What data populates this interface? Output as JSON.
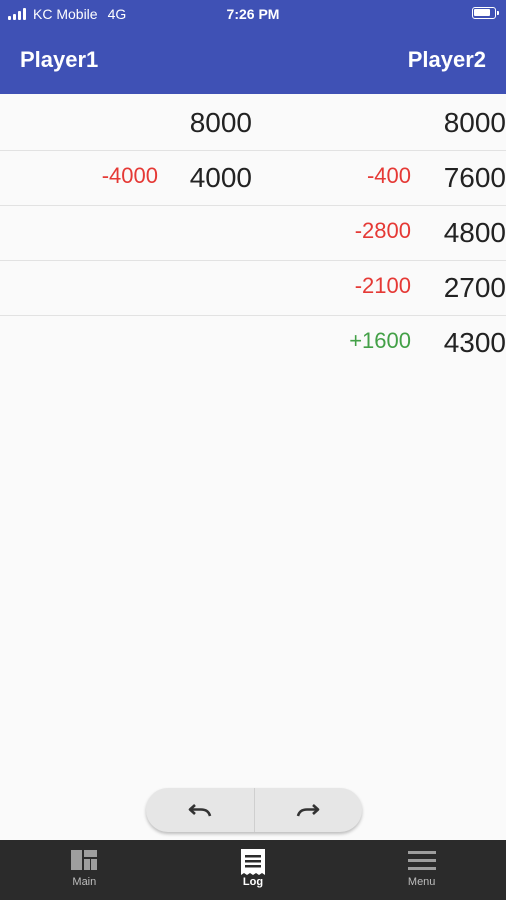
{
  "status_bar": {
    "carrier": "KC Mobile",
    "network": "4G",
    "time": "7:26 PM",
    "battery_level": 0.85
  },
  "header": {
    "player1": "Player1",
    "player2": "Player2"
  },
  "log_rows": [
    {
      "p1_delta": "",
      "p1_score": "8000",
      "p2_delta": "",
      "p2_score": "8000"
    },
    {
      "p1_delta": "-4000",
      "p1_score": "4000",
      "p2_delta": "-400",
      "p2_score": "7600"
    },
    {
      "p1_delta": "",
      "p1_score": "",
      "p2_delta": "-2800",
      "p2_score": "4800"
    },
    {
      "p1_delta": "",
      "p1_score": "",
      "p2_delta": "-2100",
      "p2_score": "2700"
    },
    {
      "p1_delta": "",
      "p1_score": "",
      "p2_delta": "+1600",
      "p2_score": "4300"
    }
  ],
  "controls": {
    "undo_icon": "undo-icon",
    "redo_icon": "redo-icon"
  },
  "nav": {
    "items": [
      {
        "label": "Main",
        "icon": "dashboard-icon",
        "active": false
      },
      {
        "label": "Log",
        "icon": "log-icon",
        "active": true
      },
      {
        "label": "Menu",
        "icon": "menu-icon",
        "active": false
      }
    ]
  },
  "colors": {
    "header": "#3f51b5",
    "negative": "#e53935",
    "positive": "#43a047",
    "nav_bg": "#2b2b2b"
  }
}
